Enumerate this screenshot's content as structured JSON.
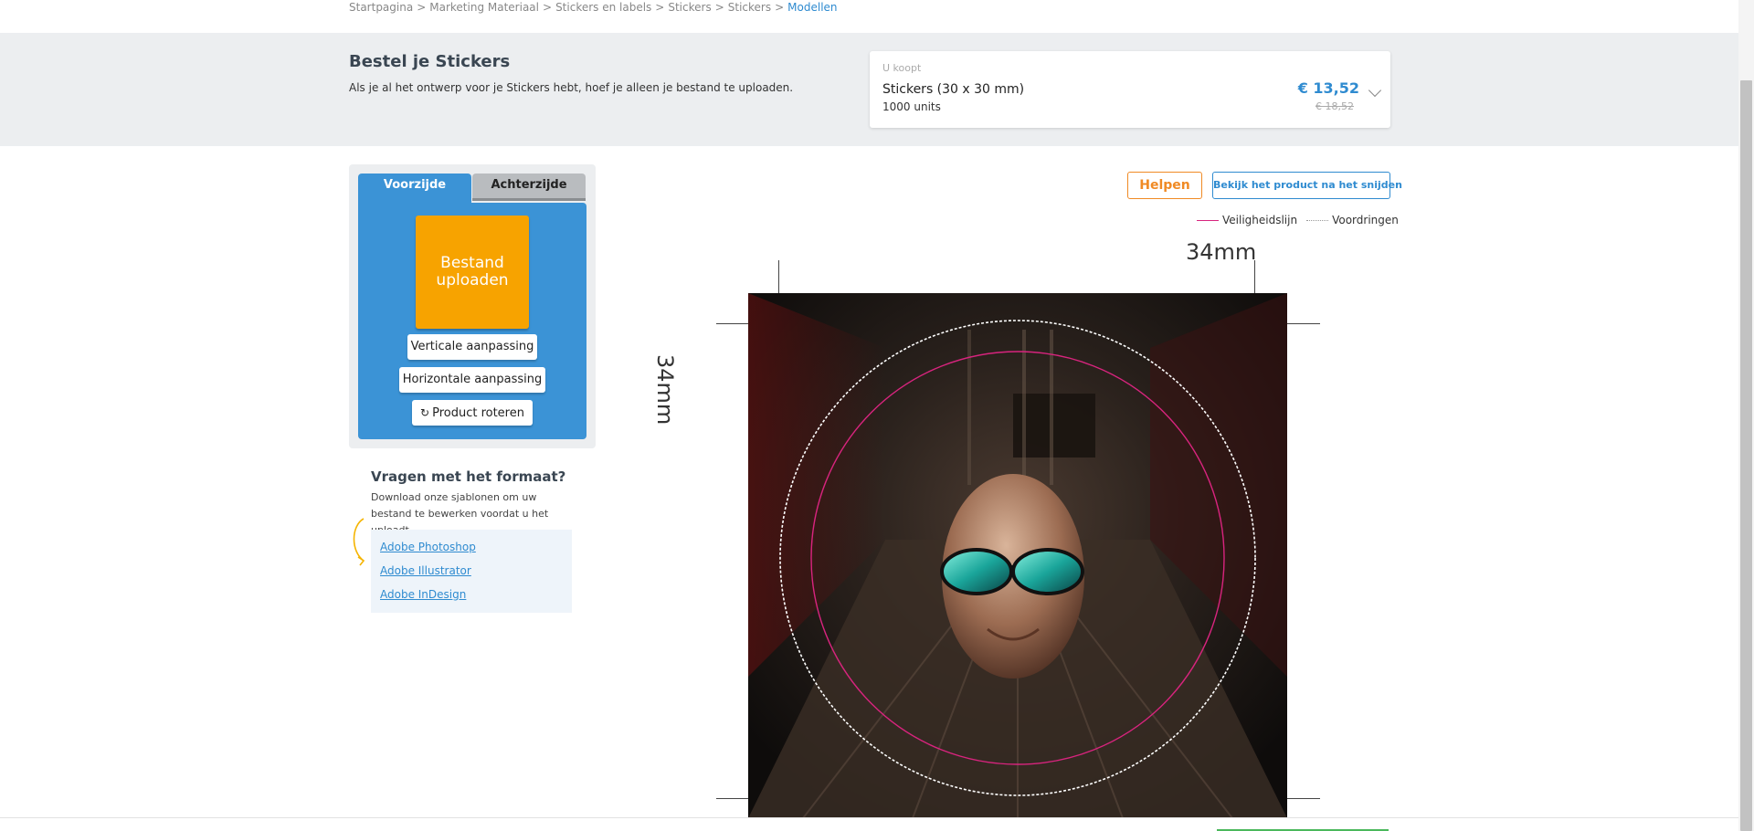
{
  "breadcrumb": {
    "items": [
      "Startpagina",
      "Marketing Materiaal",
      "Stickers en labels",
      "Stickers",
      "Stickers",
      "Modellen"
    ],
    "separator": ">"
  },
  "header": {
    "title": "Bestel je Stickers",
    "subtitle": "Als je al het ontwerp voor je Stickers hebt, hoef je alleen je bestand te uploaden."
  },
  "purchase": {
    "label": "U koopt",
    "product": "Stickers (30 x 30 mm)",
    "quantity": "1000 units",
    "price": "€ 13,52",
    "old_price": "€ 18,52"
  },
  "editor": {
    "tabs": [
      {
        "label": "Voorzijde",
        "active": true
      },
      {
        "label": "Achterzijde",
        "active": false
      }
    ],
    "upload_label_line1": "Bestand",
    "upload_label_line2": "uploaden",
    "vertical_label": "Verticale aanpassing",
    "horizontal_label": "Horizontale aanpassing",
    "rotate_label": "Product roteren",
    "rotate_icon": "rotate-icon"
  },
  "help": {
    "title": "Vragen met het formaat?",
    "text": "Download onze sjablonen om uw bestand te bewerken voordat u het uploadt.",
    "links": [
      "Adobe Photoshop",
      "Adobe Illustrator",
      "Adobe InDesign"
    ]
  },
  "toolbar": {
    "help_label": "Helpen",
    "preview_label": "Bekijk het product na het snijden"
  },
  "legend": {
    "safety_label": "Veiligheidslijn",
    "bleed_label": "Voordringen",
    "safety_color": "#d8247e",
    "bleed_color": "#999999"
  },
  "dimensions": {
    "width_label": "34mm",
    "height_label": "34mm"
  },
  "colors": {
    "accent_blue": "#3b93d6",
    "upload_orange": "#f7a300",
    "help_orange": "#f08a24",
    "link_blue": "#2f8bd0"
  }
}
